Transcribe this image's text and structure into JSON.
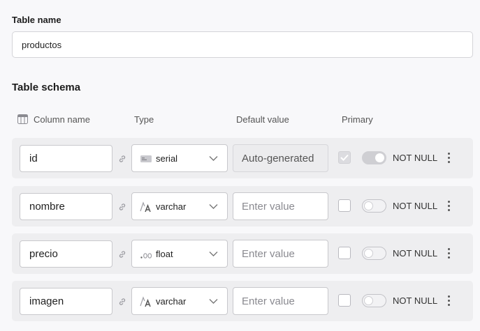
{
  "table_name": {
    "label": "Table name",
    "value": "productos"
  },
  "schema": {
    "title": "Table schema",
    "headers": {
      "column_name": "Column name",
      "type": "Type",
      "default_value": "Default value",
      "primary": "Primary"
    },
    "placeholder": "Enter value",
    "not_null_label": "NOT NULL",
    "rows": [
      {
        "name": "id",
        "type": "serial",
        "type_icon": "serial-icon",
        "default": "Auto-generated",
        "primary": true,
        "not_null": true
      },
      {
        "name": "nombre",
        "type": "varchar",
        "type_icon": "text-type-icon",
        "default": "",
        "primary": false,
        "not_null": false
      },
      {
        "name": "precio",
        "type": "float",
        "type_icon": "decimal-icon",
        "default": "",
        "primary": false,
        "not_null": false
      },
      {
        "name": "imagen",
        "type": "varchar",
        "type_icon": "text-type-icon",
        "default": "",
        "primary": false,
        "not_null": false
      }
    ]
  }
}
